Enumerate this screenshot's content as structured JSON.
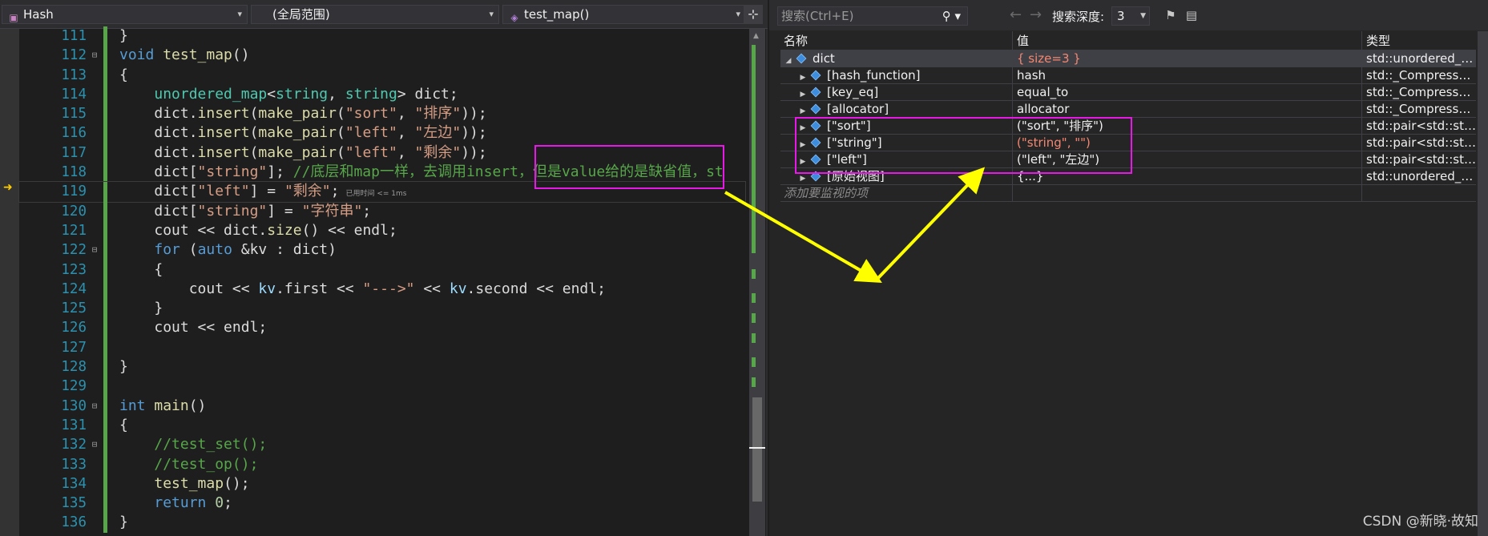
{
  "editor": {
    "nav": {
      "project": "Hash",
      "scope": "(全局范围)",
      "function": "test_map()"
    },
    "lines": [
      {
        "n": "111",
        "fold": "",
        "html": "<span class='id'>}</span>"
      },
      {
        "n": "112",
        "fold": "⊟",
        "html": "<span class='kw'>void</span> <span class='fn'>test_map</span><span class='id'>()</span>"
      },
      {
        "n": "113",
        "fold": "",
        "html": "<span class='id'>{</span>"
      },
      {
        "n": "114",
        "fold": "",
        "html": "    <span class='ty'>unordered_map</span><span class='id'>&lt;</span><span class='ty'>string</span><span class='id'>, </span><span class='ty'>string</span><span class='id'>&gt; dict;</span>"
      },
      {
        "n": "115",
        "fold": "",
        "html": "    <span class='id'>dict.</span><span class='fn'>insert</span><span class='id'>(</span><span class='fn'>make_pair</span><span class='id'>(</span><span class='st'>\"sort\"</span><span class='id'>, </span><span class='st'>\"排序\"</span><span class='id'>));</span>"
      },
      {
        "n": "116",
        "fold": "",
        "html": "    <span class='id'>dict.</span><span class='fn'>insert</span><span class='id'>(</span><span class='fn'>make_pair</span><span class='id'>(</span><span class='st'>\"left\"</span><span class='id'>, </span><span class='st'>\"左边\"</span><span class='id'>));</span>"
      },
      {
        "n": "117",
        "fold": "",
        "html": "    <span class='id'>dict.</span><span class='fn'>insert</span><span class='id'>(</span><span class='fn'>make_pair</span><span class='id'>(</span><span class='st'>\"left\"</span><span class='id'>, </span><span class='st'>\"剩余\"</span><span class='id'>));</span>"
      },
      {
        "n": "118",
        "fold": "",
        "html": "    <span class='id'>dict[</span><span class='st'>\"string\"</span><span class='id'>]; </span><span class='cm'>//底层和map一样，去调用insert，但是value给的是缺省值，st</span>"
      },
      {
        "n": "119",
        "fold": "",
        "html": "    <span class='id'>dict[</span><span class='st'>\"left\"</span><span class='id'>] = </span><span class='st'>\"剩余\"</span><span class='id'>;</span><span class='timer'>已用时间 &lt;= 1ms</span>",
        "current": true
      },
      {
        "n": "120",
        "fold": "",
        "html": "    <span class='id'>dict[</span><span class='st'>\"string\"</span><span class='id'>] = </span><span class='st'>\"字符串\"</span><span class='id'>;</span>"
      },
      {
        "n": "121",
        "fold": "",
        "html": "    <span class='id'>cout &lt;&lt; dict.</span><span class='fn'>size</span><span class='id'>() &lt;&lt; endl;</span>"
      },
      {
        "n": "122",
        "fold": "⊟",
        "html": "    <span class='kw'>for</span><span class='id'> (</span><span class='kw'>auto</span><span class='id'> &amp;kv : dict)</span>"
      },
      {
        "n": "123",
        "fold": "",
        "html": "    <span class='id'>{</span>"
      },
      {
        "n": "124",
        "fold": "",
        "html": "        <span class='id'>cout &lt;&lt; </span><span class='vr'>kv</span><span class='id'>.first &lt;&lt; </span><span class='st'>\"---&gt;\"</span><span class='id'> &lt;&lt; </span><span class='vr'>kv</span><span class='id'>.second &lt;&lt; endl;</span>"
      },
      {
        "n": "125",
        "fold": "",
        "html": "    <span class='id'>}</span>"
      },
      {
        "n": "126",
        "fold": "",
        "html": "    <span class='id'>cout &lt;&lt; endl;</span>"
      },
      {
        "n": "127",
        "fold": "",
        "html": ""
      },
      {
        "n": "128",
        "fold": "",
        "html": "<span class='id'>}</span>"
      },
      {
        "n": "129",
        "fold": "",
        "html": ""
      },
      {
        "n": "130",
        "fold": "⊟",
        "html": "<span class='kw'>int</span> <span class='fn'>main</span><span class='id'>()</span>"
      },
      {
        "n": "131",
        "fold": "",
        "html": "<span class='id'>{</span>"
      },
      {
        "n": "132",
        "fold": "⊟",
        "html": "    <span class='cm'>//test_set();</span>"
      },
      {
        "n": "133",
        "fold": "",
        "html": "    <span class='cm'>//test_op();</span>"
      },
      {
        "n": "134",
        "fold": "",
        "html": "    <span class='fn'>test_map</span><span class='id'>();</span>"
      },
      {
        "n": "135",
        "fold": "",
        "html": "    <span class='kw'>return</span><span class='id'> </span><span class='nm'>0</span><span class='id'>;</span>"
      },
      {
        "n": "136",
        "fold": "",
        "html": "<span class='id'>}</span>"
      }
    ]
  },
  "watch": {
    "search_placeholder": "搜索(Ctrl+E)",
    "depth_label": "搜索深度:",
    "depth_value": "3",
    "columns": {
      "name": "名称",
      "value": "值",
      "type": "类型"
    },
    "rows": [
      {
        "indent": 0,
        "expander": "◢",
        "name": "dict",
        "value": "{ size=3 }",
        "type": "std::unordered_map<std::...",
        "changed": true,
        "selected": true
      },
      {
        "indent": 1,
        "expander": "▶",
        "name": "[hash_function]",
        "value": "hash",
        "type": "std::_Compressed_pair<std::..."
      },
      {
        "indent": 1,
        "expander": "▶",
        "name": "[key_eq]",
        "value": "equal_to",
        "type": "std::_Compressed_pair<std::..."
      },
      {
        "indent": 1,
        "expander": "▶",
        "name": "[allocator]",
        "value": "allocator",
        "type": "std::_Compressed_pair<std::..."
      },
      {
        "indent": 1,
        "expander": "▶",
        "name": "[\"sort\"]",
        "value": "(\"sort\", \"排序\")",
        "type": "std::pair<std::string const..."
      },
      {
        "indent": 1,
        "expander": "▶",
        "name": "[\"string\"]",
        "value": "(\"string\", \"\")",
        "type": "std::pair<std::string const...",
        "changed": true
      },
      {
        "indent": 1,
        "expander": "▶",
        "name": "[\"left\"]",
        "value": "(\"left\", \"左边\")",
        "type": "std::pair<std::string const..."
      },
      {
        "indent": 1,
        "expander": "▶",
        "name": "[原始视图]",
        "value": "{...}",
        "type": "std::unordered_map<std::..."
      }
    ],
    "add_watch": "添加要监视的项"
  },
  "watermark": "CSDN @新晓·故知",
  "colors": {
    "highlight": "#e619e6",
    "arrow": "#ffff00"
  }
}
